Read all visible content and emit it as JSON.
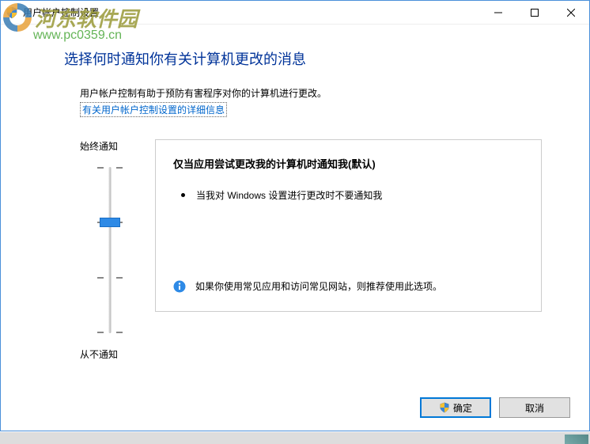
{
  "window": {
    "title": "用户帐户控制设置"
  },
  "watermark": {
    "brand": "河东软件园",
    "url": "www.pc0359.cn"
  },
  "page": {
    "heading": "选择何时通知你有关计算机更改的消息",
    "subtext": "用户帐户控制有助于预防有害程序对你的计算机进行更改。",
    "link": "有关用户帐户控制设置的详细信息"
  },
  "slider": {
    "top_label": "始终通知",
    "bottom_label": "从不通知",
    "level": 2,
    "levels": 4
  },
  "panel": {
    "title": "仅当应用尝试更改我的计算机时通知我(默认)",
    "bullet1": "当我对 Windows 设置进行更改时不要通知我",
    "recommendation": "如果你使用常见应用和访问常见网站，则推荐使用此选项。"
  },
  "buttons": {
    "ok": "确定",
    "cancel": "取消"
  }
}
